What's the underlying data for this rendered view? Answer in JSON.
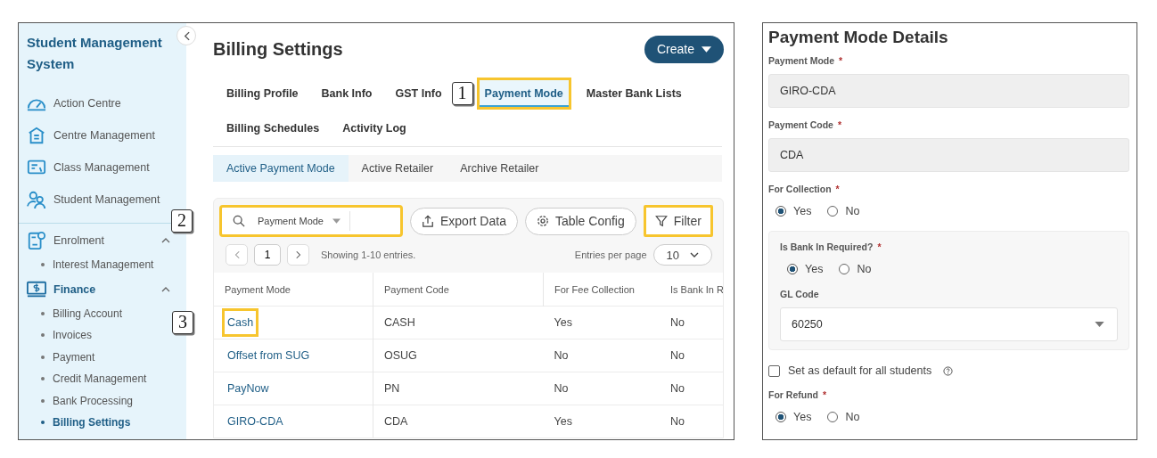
{
  "sidebar": {
    "title": "Student Management System",
    "items": [
      {
        "label": "Action Centre",
        "selected": false
      },
      {
        "label": "Centre Management",
        "selected": false
      },
      {
        "label": "Class Management",
        "selected": false
      },
      {
        "label": "Student Management",
        "selected": false
      }
    ],
    "groups": [
      {
        "label": "Enrolment",
        "expanded": true,
        "selected": false,
        "children": [
          {
            "label": "Interest Management",
            "selected": false
          }
        ]
      },
      {
        "label": "Finance",
        "expanded": true,
        "selected": true,
        "children": [
          {
            "label": "Billing Account",
            "selected": false
          },
          {
            "label": "Invoices",
            "selected": false
          },
          {
            "label": "Payment",
            "selected": false
          },
          {
            "label": "Credit Management",
            "selected": false
          },
          {
            "label": "Bank Processing",
            "selected": false
          },
          {
            "label": "Billing Settings",
            "selected": true
          }
        ]
      }
    ]
  },
  "page": {
    "title": "Billing Settings",
    "create_button": "Create"
  },
  "tabs": [
    {
      "label": "Billing Profile",
      "selected": false,
      "highlighted": false
    },
    {
      "label": "Bank Info",
      "selected": false,
      "highlighted": false
    },
    {
      "label": "GST Info",
      "selected": false,
      "highlighted": false
    },
    {
      "label": "Payment Mode",
      "selected": true,
      "highlighted": true,
      "callout": "1"
    },
    {
      "label": "Master Bank Lists",
      "selected": false,
      "highlighted": false
    },
    {
      "label": "Billing Schedules",
      "selected": false,
      "highlighted": false
    },
    {
      "label": "Activity Log",
      "selected": false,
      "highlighted": false
    }
  ],
  "subtabs": [
    {
      "label": "Active Payment Mode",
      "selected": true
    },
    {
      "label": "Active Retailer",
      "selected": false
    },
    {
      "label": "Archive Retailer",
      "selected": false
    }
  ],
  "toolbar": {
    "search": {
      "filter_label": "Payment Mode",
      "highlighted": true,
      "callout": "2"
    },
    "export_button": "Export Data",
    "config_button": "Table Config",
    "filter_button": {
      "label": "Filter",
      "highlighted": true
    }
  },
  "pagination": {
    "page": "1",
    "summary": "Showing 1-10 entries.",
    "per_page_label": "Entries per page",
    "per_page": "10"
  },
  "table": {
    "columns": [
      "Payment Mode",
      "Payment Code",
      "For Fee Collection",
      "Is Bank In R"
    ],
    "rows": [
      {
        "cells": [
          "Cash",
          "CASH",
          "Yes",
          "No"
        ],
        "highlighted": true,
        "callout": "3"
      },
      {
        "cells": [
          "Offset from SUG",
          "OSUG",
          "No",
          "No"
        ],
        "highlighted": false
      },
      {
        "cells": [
          "PayNow",
          "PN",
          "No",
          "No"
        ],
        "highlighted": false
      },
      {
        "cells": [
          "GIRO-CDA",
          "CDA",
          "Yes",
          "No"
        ],
        "highlighted": false
      }
    ]
  },
  "details": {
    "title": "Payment Mode Details",
    "fields": [
      {
        "kind": "text",
        "label": "Payment Mode",
        "required_mark": "*",
        "value": "GIRO-CDA"
      },
      {
        "kind": "text",
        "label": "Payment Code",
        "required_mark": "*",
        "value": "CDA"
      },
      {
        "kind": "radio",
        "label": "For Collection",
        "required_mark": "*",
        "options": [
          {
            "label": "Yes",
            "selected": true
          },
          {
            "label": "No",
            "selected": false
          }
        ]
      },
      {
        "kind": "panel",
        "children": [
          {
            "kind": "radio",
            "label": "Is Bank In Required?",
            "required_mark": "*",
            "options": [
              {
                "label": "Yes",
                "selected": true
              },
              {
                "label": "No",
                "selected": false
              }
            ]
          },
          {
            "kind": "select",
            "label": "GL Code",
            "value": "60250"
          }
        ]
      },
      {
        "kind": "checkbox",
        "label": "Set as default for all students",
        "checked": false
      },
      {
        "kind": "radio",
        "label": "For Refund",
        "required_mark": "*",
        "options": [
          {
            "label": "Yes",
            "selected": true
          },
          {
            "label": "No",
            "selected": false
          }
        ]
      }
    ]
  }
}
